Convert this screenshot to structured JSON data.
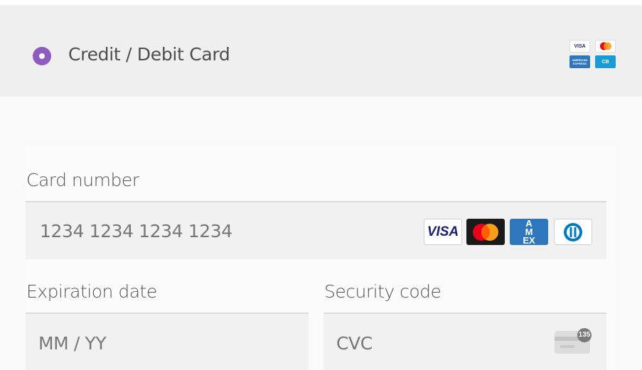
{
  "payment_method": {
    "title": "Credit / Debit Card",
    "mini_logos": [
      "VISA",
      "MC",
      "AMERICAN EXPRESS",
      "CB"
    ]
  },
  "form": {
    "card_number": {
      "label": "Card number",
      "placeholder": "1234 1234 1234 1234",
      "brands": [
        "VISA",
        "MC",
        "AM EX",
        "D"
      ]
    },
    "expiration": {
      "label": "Expiration date",
      "placeholder": "MM / YY"
    },
    "security_code": {
      "label": "Security code",
      "placeholder": "CVC",
      "cvc_hint": "135"
    }
  },
  "colors": {
    "accent": "#8e5bc1",
    "header_bg": "#efefef",
    "field_bg": "#f1f1f1"
  }
}
